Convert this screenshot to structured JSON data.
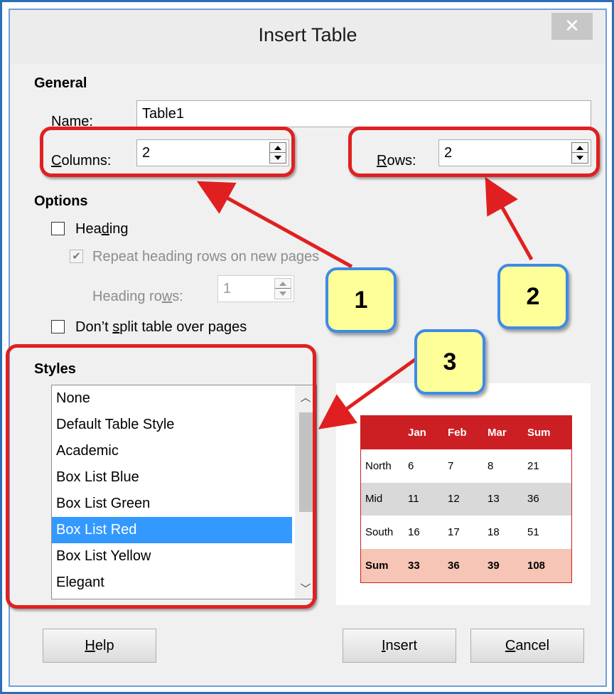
{
  "dialog": {
    "title": "Insert Table",
    "close_glyph": "✕"
  },
  "general": {
    "section": "General",
    "name_label": "Name:",
    "name_value": "Table1",
    "columns_label": "Columns:",
    "columns_value": "2",
    "rows_label": "Rows:",
    "rows_value": "2"
  },
  "options": {
    "section": "Options",
    "heading": {
      "label": "Heading",
      "checked": false
    },
    "repeat_heading": {
      "label": "Repeat heading rows on new pages",
      "checked": true,
      "enabled": false
    },
    "heading_rows": {
      "label": "Heading rows:",
      "value": "1",
      "enabled": false
    },
    "dont_split": {
      "label": "Don’t split table over pages",
      "checked": false
    }
  },
  "styles": {
    "section": "Styles",
    "items": [
      "None",
      "Default Table Style",
      "Academic",
      "Box List Blue",
      "Box List Green",
      "Box List Red",
      "Box List Yellow",
      "Elegant"
    ],
    "selected": "Box List Red"
  },
  "preview": {
    "header": [
      "",
      "Jan",
      "Feb",
      "Mar",
      "Sum"
    ],
    "rows": [
      [
        "North",
        "6",
        "7",
        "8",
        "21"
      ],
      [
        "Mid",
        "11",
        "12",
        "13",
        "36"
      ],
      [
        "South",
        "16",
        "17",
        "18",
        "51"
      ],
      [
        "Sum",
        "33",
        "36",
        "39",
        "108"
      ]
    ],
    "colors": {
      "header_bg": "#cc1f24",
      "alt_row_bg": "#d9d9d9",
      "total_row_bg": "#f6c5b6"
    }
  },
  "buttons": {
    "help": "Help",
    "insert": "Insert",
    "cancel": "Cancel"
  },
  "callouts": [
    "1",
    "2",
    "3"
  ],
  "annotation_colors": {
    "outline": "#e02020",
    "callout_fill": "#ffff99",
    "callout_border": "#3d8be8"
  }
}
